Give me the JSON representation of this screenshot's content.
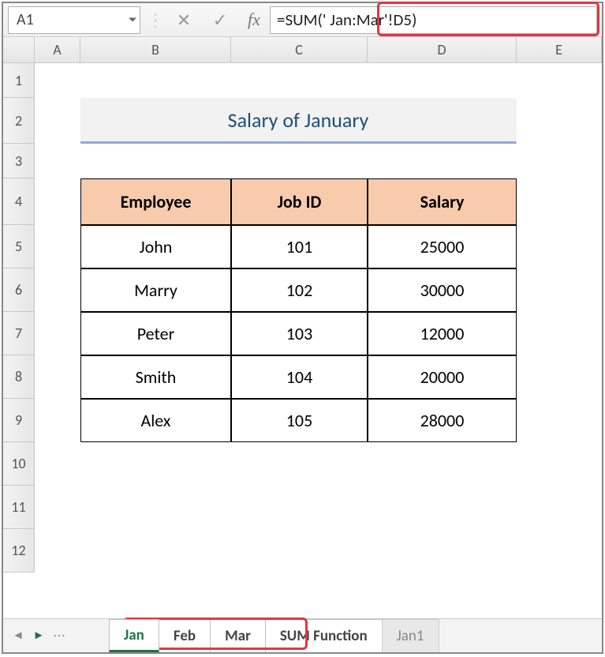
{
  "formula_bar": {
    "name_box": "A1",
    "cancel_icon": "✕",
    "confirm_icon": "✓",
    "fx_label": "fx",
    "formula": "=SUM(' Jan:Mar'!D5)"
  },
  "column_headers": [
    "A",
    "B",
    "C",
    "D",
    "E"
  ],
  "row_numbers": [
    "1",
    "2",
    "3",
    "4",
    "5",
    "6",
    "7",
    "8",
    "9",
    "10",
    "11",
    "12"
  ],
  "sheet": {
    "title": "Salary of January",
    "headers": {
      "employee": "Employee",
      "job_id": "Job ID",
      "salary": "Salary"
    },
    "rows": [
      {
        "employee": "John",
        "job_id": "101",
        "salary": "25000"
      },
      {
        "employee": "Marry",
        "job_id": "102",
        "salary": "30000"
      },
      {
        "employee": "Peter",
        "job_id": "103",
        "salary": "12000"
      },
      {
        "employee": "Smith",
        "job_id": "104",
        "salary": "20000"
      },
      {
        "employee": "Alex",
        "job_id": "105",
        "salary": "28000"
      }
    ]
  },
  "tabs": {
    "t0": "Jan",
    "t1": "Feb",
    "t2": "Mar",
    "t3": "SUM Function",
    "t4": "Jan1"
  }
}
